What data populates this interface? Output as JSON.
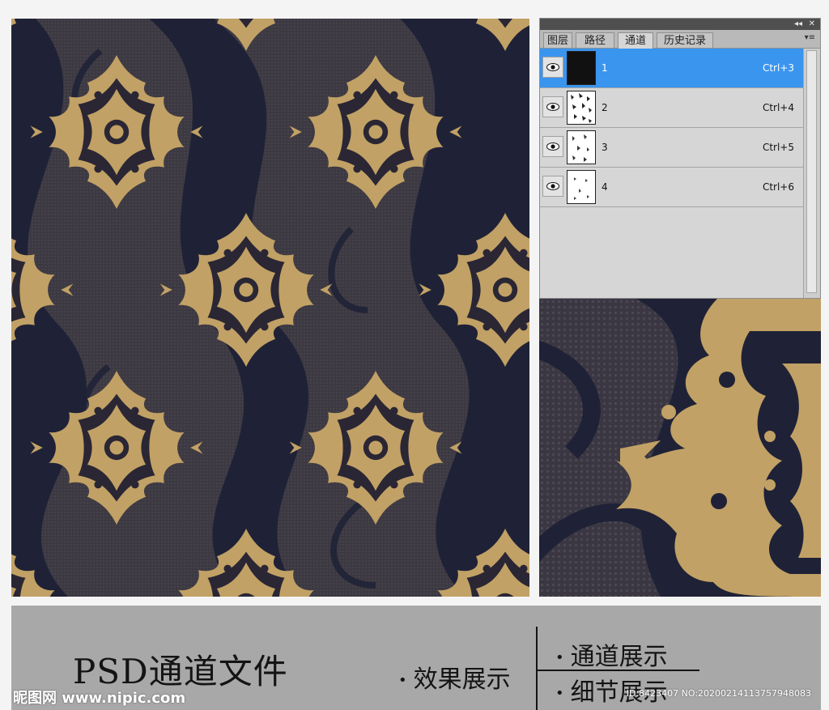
{
  "colors": {
    "navy": "#1f2236",
    "brown": "#3e3a42",
    "gold": "#c1a165",
    "selection_blue": "#3a95ef",
    "caption_gray": "#a8a8a8"
  },
  "panel": {
    "collapse_glyph": "◂◂",
    "close_glyph": "✕",
    "menu_glyph": "▾≡",
    "tabs": [
      {
        "label": "图层"
      },
      {
        "label": "路径"
      },
      {
        "label": "通道"
      },
      {
        "label": "历史记录"
      }
    ],
    "active_tab": "通道",
    "channels": [
      {
        "name": "1",
        "shortcut": "Ctrl+3",
        "selected": true
      },
      {
        "name": "2",
        "shortcut": "Ctrl+4",
        "selected": false
      },
      {
        "name": "3",
        "shortcut": "Ctrl+5",
        "selected": false
      },
      {
        "name": "4",
        "shortcut": "Ctrl+6",
        "selected": false
      }
    ],
    "eye_icon": "eye-icon"
  },
  "caption": {
    "title": "PSD通道文件",
    "bullet": "•",
    "effect": "效果展示",
    "channel": "通道展示",
    "detail": "细节展示"
  },
  "watermark": {
    "logo": "昵图网 www.nipic.com",
    "id": "ID:8423407 NO:20200214113757948083"
  }
}
